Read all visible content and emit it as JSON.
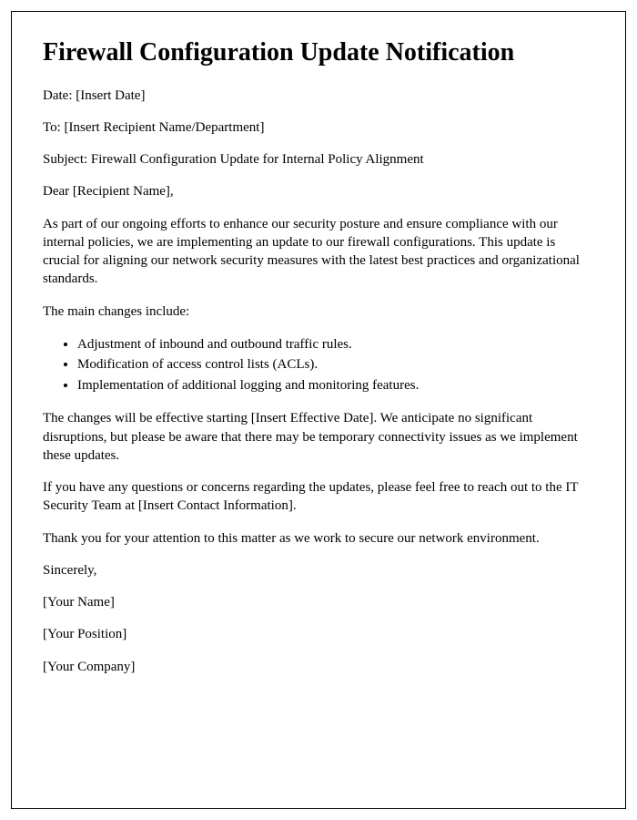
{
  "title": "Firewall Configuration Update Notification",
  "fields": {
    "date_label": "Date: ",
    "date_value": "[Insert Date]",
    "to_label": "To: ",
    "to_value": "[Insert Recipient Name/Department]",
    "subject_label": "Subject: ",
    "subject_value": "Firewall Configuration Update for Internal Policy Alignment"
  },
  "salutation": "Dear [Recipient Name],",
  "paragraphs": {
    "intro": "As part of our ongoing efforts to enhance our security posture and ensure compliance with our internal policies, we are implementing an update to our firewall configurations. This update is crucial for aligning our network security measures with the latest best practices and organizational standards.",
    "changes_lead": "The main changes include:",
    "effective": "The changes will be effective starting [Insert Effective Date]. We anticipate no significant disruptions, but please be aware that there may be temporary connectivity issues as we implement these updates.",
    "contact": "If you have any questions or concerns regarding the updates, please feel free to reach out to the IT Security Team at [Insert Contact Information].",
    "thanks": "Thank you for your attention to this matter as we work to secure our network environment."
  },
  "changes": [
    "Adjustment of inbound and outbound traffic rules.",
    "Modification of access control lists (ACLs).",
    "Implementation of additional logging and monitoring features."
  ],
  "closing": {
    "sincerely": "Sincerely,",
    "name": "[Your Name]",
    "position": "[Your Position]",
    "company": "[Your Company]"
  }
}
